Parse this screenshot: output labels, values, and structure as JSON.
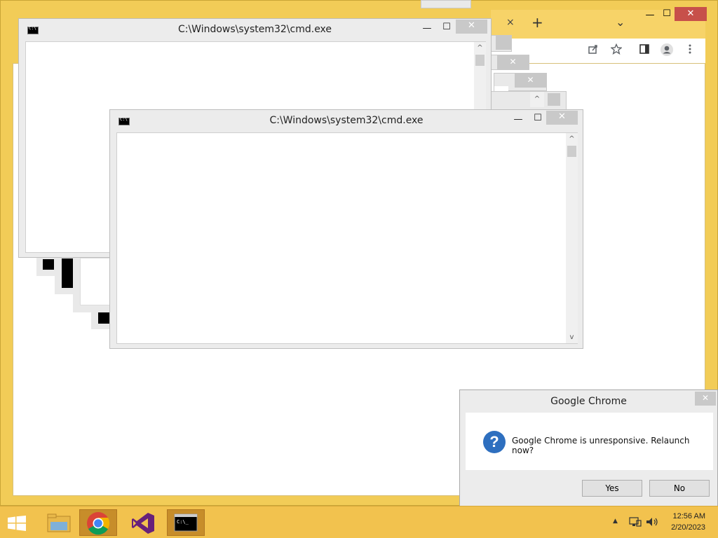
{
  "chrome": {
    "new_tab_symbol": "+",
    "tab_close_symbol": "×",
    "tab_list_symbol": "⌄",
    "minimize_symbol": "—",
    "maximize_symbol": "☐",
    "close_symbol": "✕"
  },
  "cmd_back": {
    "title": "C:\\Windows\\system32\\cmd.exe",
    "minimize_symbol": "—",
    "maximize_symbol": "☐",
    "close_symbol": "✕"
  },
  "cmd_front": {
    "title": "C:\\Windows\\system32\\cmd.exe",
    "minimize_symbol": "—",
    "maximize_symbol": "☐",
    "close_symbol": "✕",
    "scroll_up": "^",
    "scroll_down": "v"
  },
  "dialog": {
    "title": "Google Chrome",
    "close_symbol": "✕",
    "icon_glyph": "?",
    "message": "Google Chrome is unresponsive. Relaunch now?",
    "yes_label": "Yes",
    "no_label": "No"
  },
  "taskbar": {
    "time": "12:56 AM",
    "date": "2/20/2023",
    "tray_chevron": "▲"
  },
  "colors": {
    "frame_yellow": "#f2cc57",
    "taskbar": "#f2c24e",
    "close_red": "#c7504a",
    "question_blue": "#2e6fbf"
  }
}
